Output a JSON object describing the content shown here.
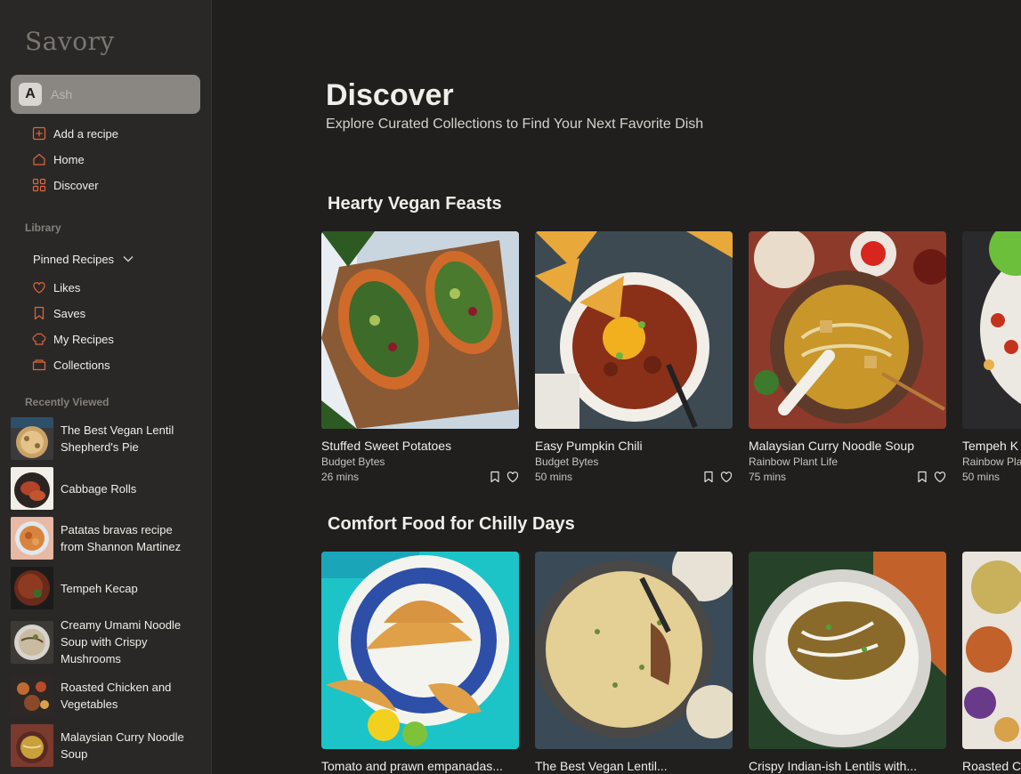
{
  "app": {
    "logo": "Savory"
  },
  "user": {
    "initial": "A",
    "name": "Ash"
  },
  "nav": [
    {
      "label": "Add a recipe",
      "icon": "plus-square-icon"
    },
    {
      "label": "Home",
      "icon": "home-icon"
    },
    {
      "label": "Discover",
      "icon": "grid-icon"
    }
  ],
  "library": {
    "heading": "Library",
    "pinned_label": "Pinned Recipes",
    "items": [
      {
        "label": "Likes",
        "icon": "heart-icon"
      },
      {
        "label": "Saves",
        "icon": "bookmark-icon"
      },
      {
        "label": "My Recipes",
        "icon": "chef-hat-icon"
      },
      {
        "label": "Collections",
        "icon": "folder-icon"
      }
    ]
  },
  "recent": {
    "heading": "Recently Viewed",
    "items": [
      {
        "title": "The Best Vegan Lentil Shepherd's Pie"
      },
      {
        "title": "Cabbage Rolls"
      },
      {
        "title": "Patatas bravas recipe from Shannon Martinez"
      },
      {
        "title": "Tempeh Kecap"
      },
      {
        "title": "Creamy Umami Noodle Soup with Crispy Mushrooms"
      },
      {
        "title": "Roasted Chicken and Vegetables"
      },
      {
        "title": "Malaysian Curry Noodle Soup"
      }
    ]
  },
  "page": {
    "title": "Discover",
    "subtitle": "Explore Curated Collections to Find Your Next Favorite Dish"
  },
  "collections": [
    {
      "title": "Hearty Vegan Feasts",
      "cards": [
        {
          "title": "Stuffed Sweet Potatoes",
          "source": "Budget Bytes",
          "time": "26 mins"
        },
        {
          "title": "Easy Pumpkin Chili",
          "source": "Budget Bytes",
          "time": "50 mins"
        },
        {
          "title": "Malaysian Curry Noodle Soup",
          "source": "Rainbow Plant Life",
          "time": "75 mins"
        },
        {
          "title": "Tempeh K",
          "source": "Rainbow Pla",
          "time": "50 mins"
        }
      ]
    },
    {
      "title": "Comfort Food for Chilly Days",
      "cards": [
        {
          "title": "Tomato and prawn empanadas..."
        },
        {
          "title": "The Best Vegan Lentil..."
        },
        {
          "title": "Crispy Indian-ish Lentils with..."
        },
        {
          "title": "Roasted C"
        }
      ]
    }
  ],
  "colors": {
    "background": "#201f1e",
    "sidebar": "#2a2827",
    "accent": "#e0663a",
    "text": "#f1ede8",
    "muted": "#85807a"
  }
}
